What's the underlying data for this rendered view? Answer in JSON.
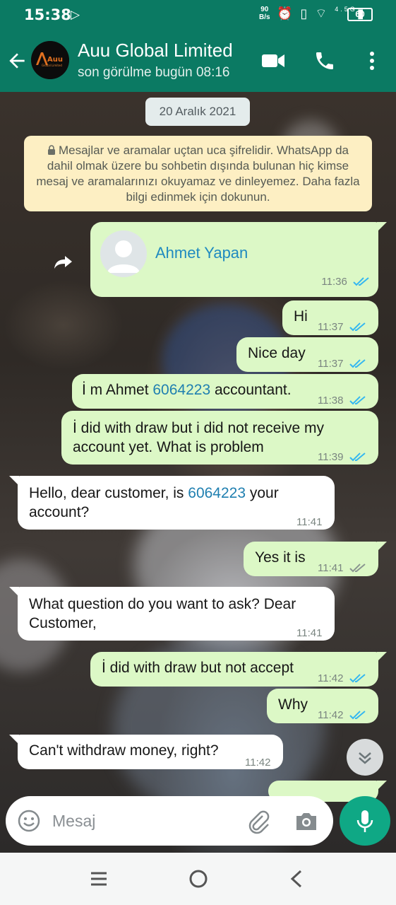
{
  "status_bar": {
    "time": "15:38",
    "speed_value": "90",
    "speed_unit": "B/s",
    "network": "4.5G",
    "battery": "60"
  },
  "header": {
    "title": "Auu Global Limited",
    "subtitle": "son görülme bugün 08:16",
    "avatar_logo_text": "Auu",
    "avatar_logo_sub": "Global Limited"
  },
  "chat": {
    "date_chip": "20 Aralık 2021",
    "encryption_note": "Mesajlar ve aramalar uçtan uca şifrelidir. WhatsApp da dahil olmak üzere bu sohbetin dışında bulunan hiç kimse mesaj ve aramalarınızı okuyamaz ve dinleyemez. Daha fazla bilgi edinmek için dokunun.",
    "contact_card": {
      "name": "Ahmet Yapan",
      "time": "11:36",
      "status": "read"
    },
    "messages": [
      {
        "dir": "out",
        "text": "Hi",
        "time": "11:37",
        "status": "read"
      },
      {
        "dir": "out",
        "text": "Nice day",
        "time": "11:37",
        "status": "read"
      },
      {
        "dir": "out",
        "text_before": "İ m Ahmet ",
        "number": "6064223",
        "text_after": " accountant.",
        "time": "11:38",
        "status": "read"
      },
      {
        "dir": "out",
        "line1": "İ did with draw but i did not receive my",
        "line2": "account yet. What is problem",
        "time": "11:39",
        "status": "read"
      },
      {
        "dir": "in",
        "line1_before": "Hello, dear customer, is ",
        "number": "6064223",
        "line1_after": " your",
        "line2": "account?",
        "time": "11:41"
      },
      {
        "dir": "out",
        "text": "Yes it is",
        "time": "11:41",
        "status": "delivered"
      },
      {
        "dir": "in",
        "line1": "What question do you want to ask? Dear",
        "line2": "Customer,",
        "time": "11:41"
      },
      {
        "dir": "out",
        "text": "İ did with draw but not accept",
        "time": "11:42",
        "status": "read"
      },
      {
        "dir": "out",
        "text": "Why",
        "time": "11:42",
        "status": "read"
      },
      {
        "dir": "in",
        "text": "Can't withdraw money, right?",
        "time": "11:42"
      }
    ]
  },
  "input": {
    "placeholder": "Mesaj"
  },
  "colors": {
    "header": "#0b7a63",
    "outgoing_bubble": "#dcf8c6",
    "incoming_bubble": "#ffffff",
    "read_tick": "#34b7f1",
    "mic_button": "#0fa885"
  },
  "icons": [
    "back-arrow-icon",
    "video-call-icon",
    "phone-icon",
    "more-vertical-icon",
    "lock-icon",
    "forward-icon",
    "double-check-icon",
    "chevron-down-icon",
    "emoji-icon",
    "attach-icon",
    "camera-icon",
    "mic-icon"
  ]
}
